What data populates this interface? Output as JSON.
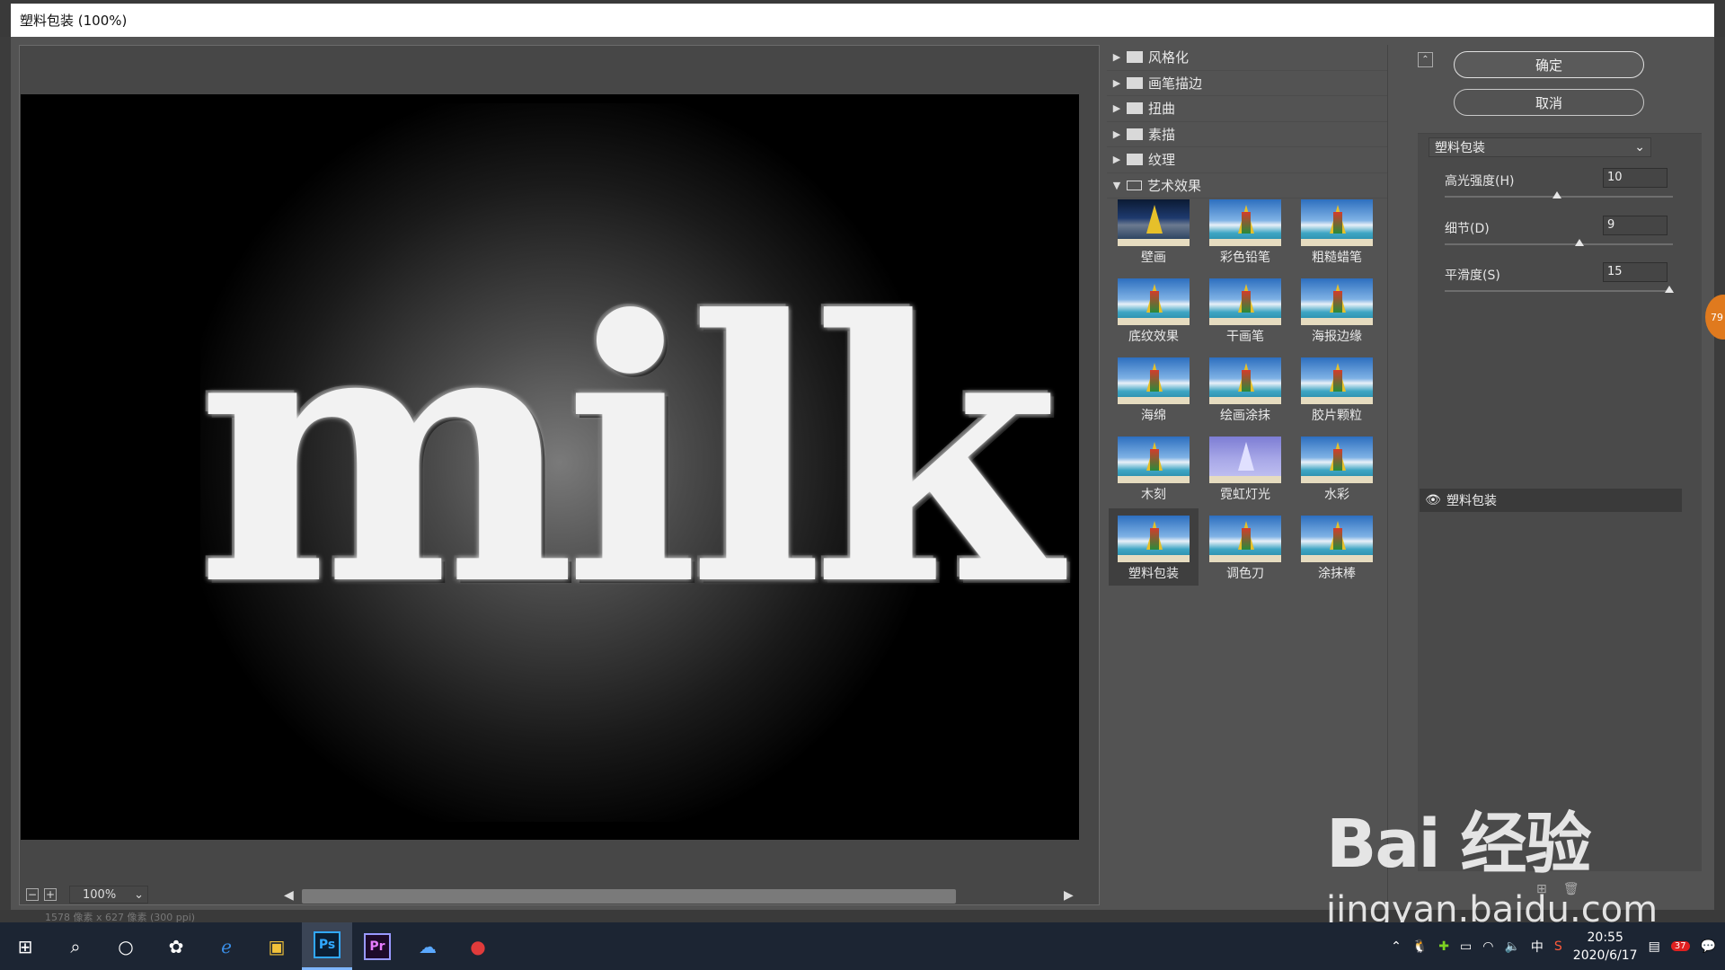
{
  "window": {
    "title": "塑料包装 (100%)"
  },
  "preview": {
    "text": "milk",
    "zoom": "100%",
    "status": "1578 像素 x 627 像素 (300 ppi)"
  },
  "gallery": {
    "categories": [
      {
        "label": "风格化",
        "expanded": false
      },
      {
        "label": "画笔描边",
        "expanded": false
      },
      {
        "label": "扭曲",
        "expanded": false
      },
      {
        "label": "素描",
        "expanded": false
      },
      {
        "label": "纹理",
        "expanded": false
      },
      {
        "label": "艺术效果",
        "expanded": true
      }
    ],
    "filters": [
      "壁画",
      "彩色铅笔",
      "粗糙蜡笔",
      "底纹效果",
      "干画笔",
      "海报边缘",
      "海绵",
      "绘画涂抹",
      "胶片颗粒",
      "木刻",
      "霓虹灯光",
      "水彩",
      "塑料包装",
      "调色刀",
      "涂抹棒"
    ],
    "selected": "塑料包装"
  },
  "buttons": {
    "ok": "确定",
    "cancel": "取消"
  },
  "settings": {
    "filter": "塑料包装",
    "params": [
      {
        "label": "高光强度(H)",
        "value": "10",
        "fraction": 0.5
      },
      {
        "label": "细节(D)",
        "value": "9",
        "fraction": 0.6
      },
      {
        "label": "平滑度(S)",
        "value": "15",
        "fraction": 1.0
      }
    ]
  },
  "layers": [
    {
      "label": "塑料包装",
      "visible": true
    }
  ],
  "watermark": {
    "brand": "Bai 经验",
    "url": "jingyan.baidu.com"
  },
  "badge": "79",
  "taskbar": {
    "apps": [
      "windows-start",
      "search",
      "cortana",
      "app",
      "edge",
      "photos",
      "Ps",
      "Pr",
      "baidu-netdisk",
      "app-red"
    ],
    "ps_label": "Ps",
    "pr_label": "Pr",
    "ime": "中",
    "time": "20:55",
    "date": "2020/6/17",
    "notifications": "37"
  },
  "colors": {
    "dialog_bg": "#535353",
    "canvas_bg": "#000000",
    "taskbar_bg": "#1c2533",
    "badge": "#e07a1e"
  }
}
